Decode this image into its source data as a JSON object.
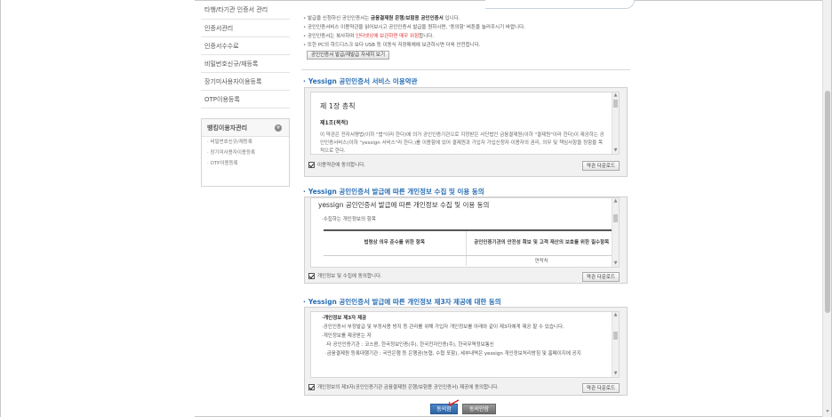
{
  "sidebar": {
    "items": [
      {
        "label": "타행/타기관 인증서 관리"
      },
      {
        "label": "인증서관리"
      },
      {
        "label": "인증서수수료"
      },
      {
        "label": "비밀번호신규/재등록"
      },
      {
        "label": "장기미사용자이용등록"
      },
      {
        "label": "OTP이용등록"
      }
    ],
    "box": {
      "title": "뱅킹이용자관리",
      "plus_icon": "+",
      "items": [
        {
          "label": "· 비밀번호신규/재등록"
        },
        {
          "label": "· 장기미사용자이용등록"
        },
        {
          "label": "· OTP이용등록"
        }
      ]
    }
  },
  "notes": {
    "line1_a": "발급을 신청하신 공인인증서는 ",
    "line1_b": "금융결제원 은행/보험용 공인인증서",
    "line1_c": " 입니다.",
    "line2": "공인인증서비스 이용약관을 읽어보시고 공인인증서 발급을 원하시면, '동의함' 버튼을 눌러주시기 바랍니다.",
    "line3_a": "공인인증서는 복사하여 ",
    "line3_b": "인터넷상에 보관하면 매우 위험",
    "line3_c": "합니다.",
    "line4": "또한 PC의 하드디스크 보다 USB 등 이동식 저장매체에 보관하시면 더욱 안전합니다.",
    "sample_button": "공인인증서 발급/재발급 자세히 보기"
  },
  "section1": {
    "title": "Yessign 공인인증서 서비스 이용약관",
    "heading": "제 1장 총칙",
    "article": "제1조(목적)",
    "body": "이 약관은 전자서명법(이하 \"법\"이라 한다)에 의거 공인인증기관으로 지정받은 사단법인 금융결제원(이하 \"결제원\"이라 한다)이 제공하는 공인인증서비스(이하 \"yessign 서비스\"라 한다.)를 이용함에 있어 결제원과 가입자 가입신청자·이용자의 권리, 의무 및 책임사항을 정함을 목적으로 한다.",
    "agree_label": "이용약관에 동의합니다.",
    "download": "약관 다운로드"
  },
  "section2": {
    "title": "Yessign 공인인증서 발급에 따른 개인정보 수집 및 이용 동의",
    "doc_title": "yessign 공인인증서 발급에 따른 개인정보 수집 및 이용 동의",
    "bullet": "수집하는 개인정보의 항목",
    "col1": "법령상 의무 준수를 위한 항목",
    "col2": "공인인증기관의 안전성 확보 및 고객 재산의 보호를 위한 필수항목",
    "cell2": "연락처",
    "agree_label": "개인정보 및 수집에 동의합니다.",
    "download": "약관 다운로드"
  },
  "section3": {
    "title": "Yessign 공인인증서 발급에 따른 개인정보 제3자 제공에 대한 동의",
    "bullet1": "개인정보 제3자 제공",
    "bullet2": "공인인증서 부정발급 및 부정사용 방지 등 관리를 위해 가입자 개인정보를 아래와 같이 제3자에게 제공 할 수 있습니다.",
    "bullet3": "개인정보를 제공받는 자",
    "bullet4": "타 공인인증기관 : 코스콤, 한국정보인증(주), 한국전자인증(주), 한국무역정보통신",
    "bullet5": "금융결제원 등록대행기관 : 국민은행 등 은행권(농협, 수협 포함), 세부내역은 yessign 개인정보처리방침 및 홈페이지에 공지",
    "agree_label": "개인정보의 제3자(공인인증기관 금융결제원 은행/보험용 공인인증서) 제공에 동의합니다.",
    "download": "약관 다운로드"
  },
  "buttons": {
    "agree": "동의함",
    "disagree": "동의안함"
  },
  "colors": {
    "accent": "#2a6fb5",
    "agree_btn": "#2e64a3",
    "warning": "#dd3333"
  }
}
